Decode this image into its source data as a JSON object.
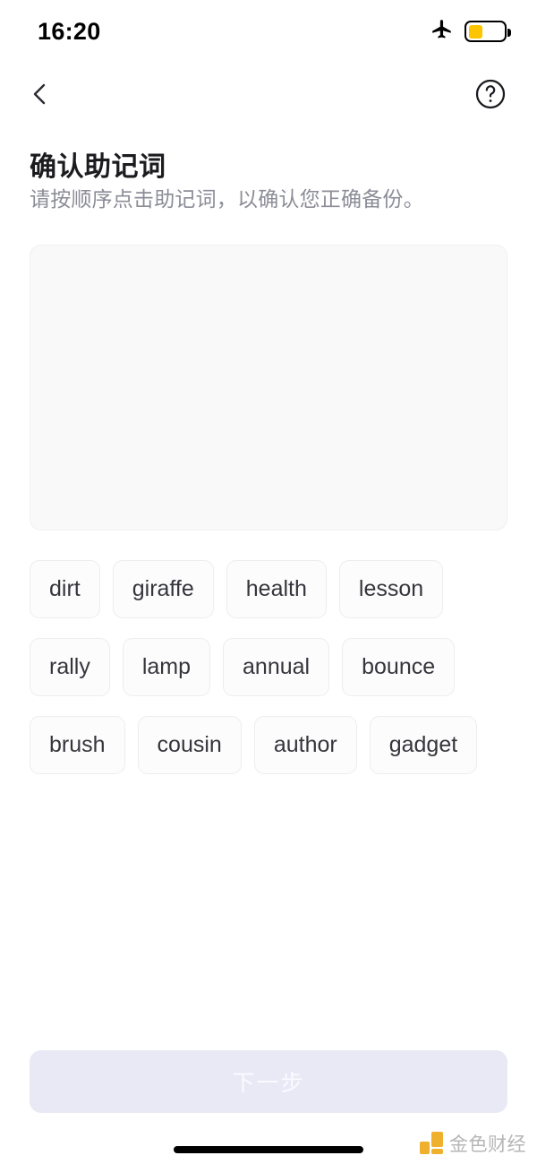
{
  "status_bar": {
    "time": "16:20",
    "airplane_icon": "airplane-icon",
    "battery_icon": "battery-icon",
    "battery_level_percent": 40,
    "battery_color": "#fdc500"
  },
  "nav_bar": {
    "back_icon": "chevron-left-icon",
    "help_icon": "question-circle-icon"
  },
  "header": {
    "title": "确认助记词",
    "subtitle": "请按顺序点击助记词，以确认您正确备份。"
  },
  "answer_area": {
    "selected_words": [],
    "background_color": "#f9f9f9"
  },
  "word_pool": {
    "words": [
      "dirt",
      "giraffe",
      "health",
      "lesson",
      "rally",
      "lamp",
      "annual",
      "bounce",
      "brush",
      "cousin",
      "author",
      "gadget"
    ]
  },
  "footer": {
    "next_label": "下一步",
    "next_enabled": false,
    "next_bg_color": "#e9e9f6",
    "next_text_color": "#fafaff"
  },
  "watermark": {
    "text": "金色财经",
    "logo_color": "#edaa1c"
  }
}
